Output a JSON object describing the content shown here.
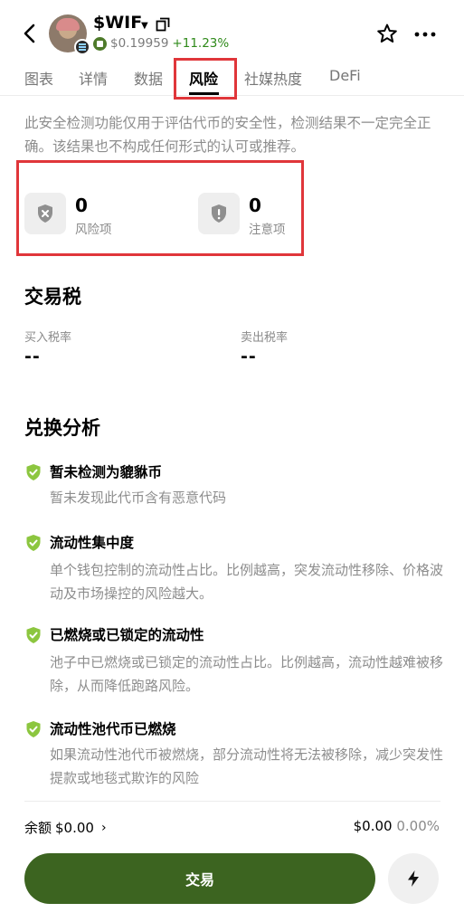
{
  "header": {
    "token_name": "$WIF",
    "price": "$0.19959",
    "change": "+11.23%"
  },
  "tabs": [
    {
      "label": "图表"
    },
    {
      "label": "详情"
    },
    {
      "label": "数据"
    },
    {
      "label": "风险",
      "active": true
    },
    {
      "label": "社媒热度"
    },
    {
      "label": "DeFi"
    }
  ],
  "disclaimer": "此安全检测功能仅用于评估代币的安全性，检测结果不一定完全正确。该结果也不构成任何形式的认可或推荐。",
  "stats": {
    "risk": {
      "value": "0",
      "label": "风险项"
    },
    "caution": {
      "value": "0",
      "label": "注意项"
    }
  },
  "tax": {
    "title": "交易税",
    "buy_label": "买入税率",
    "buy_value": "--",
    "sell_label": "卖出税率",
    "sell_value": "--"
  },
  "analysis": {
    "title": "兑换分析",
    "items": [
      {
        "title": "暂未检测为貔貅币",
        "desc": "暂未发现此代币含有恶意代码"
      },
      {
        "title": "流动性集中度",
        "desc": "单个钱包控制的流动性占比。比例越高，突发流动性移除、价格波动及市场操控的风险越大。"
      },
      {
        "title": "已燃烧或已锁定的流动性",
        "desc": "池子中已燃烧或已锁定的流动性占比。比例越高，流动性越难被移除，从而降低跑路风险。"
      },
      {
        "title": "流动性池代币已燃烧",
        "desc": "如果流动性池代币被燃烧，部分流动性将无法被移除，减少突发性提款或地毯式欺诈的风险"
      }
    ]
  },
  "footer": {
    "balance_label": "余额",
    "balance_value": "$0.00",
    "value": "$0.00",
    "pct": "0.00%",
    "trade_label": "交易"
  },
  "colors": {
    "accent_green": "#3c6420",
    "positive": "#2f8a1a",
    "shield_green": "#8cc63f",
    "highlight_red": "#e0363a"
  },
  "icons": [
    "back-arrow-icon",
    "copy-icon",
    "star-icon",
    "more-icon",
    "shield-x-icon",
    "shield-exclamation-icon",
    "shield-check-icon",
    "chevron-right-icon",
    "lightning-icon"
  ]
}
